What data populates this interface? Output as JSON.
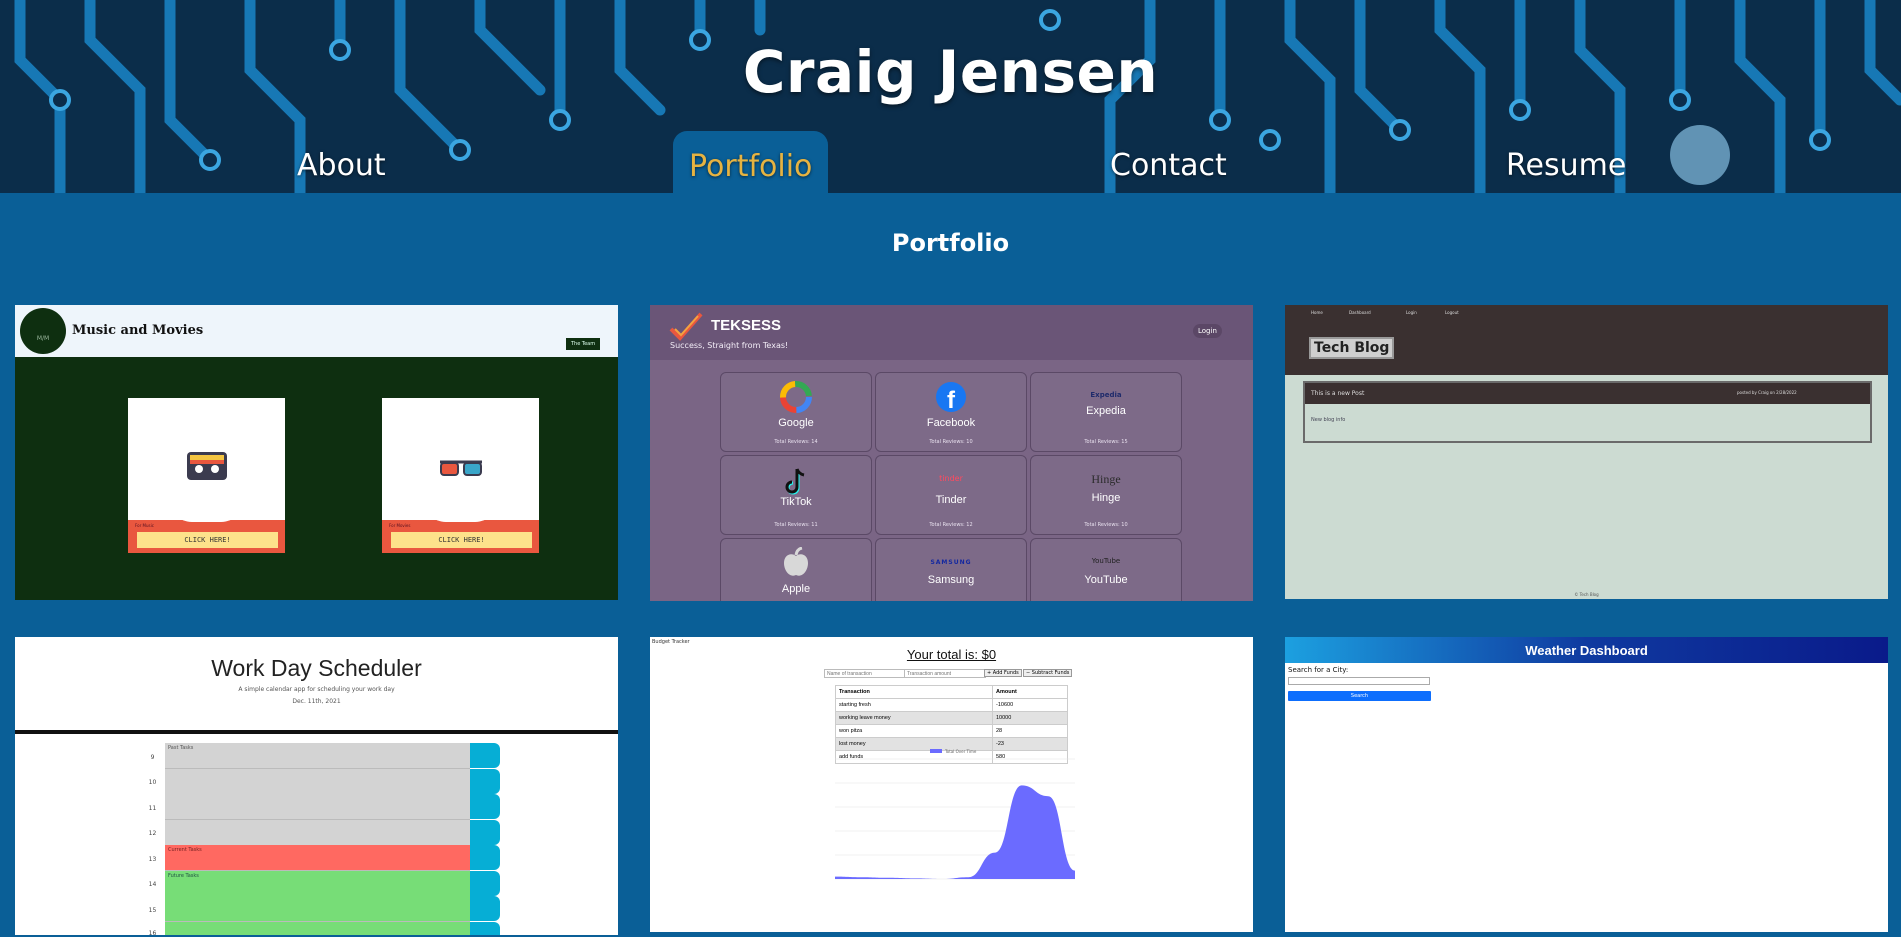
{
  "site": {
    "title": "Craig Jensen"
  },
  "nav": [
    {
      "label": "About",
      "active": false
    },
    {
      "label": "Portfolio",
      "active": true
    },
    {
      "label": "Contact",
      "active": false
    },
    {
      "label": "Resume",
      "active": false
    }
  ],
  "section": {
    "title": "Portfolio"
  },
  "projects": {
    "music": {
      "title": "Music and Movies",
      "logo_text": "M/M",
      "team_button": "The Team",
      "cards": [
        {
          "label": "For Music",
          "button": "CLICK HERE!",
          "icon": "cassette-icon"
        },
        {
          "label": "For Movies",
          "button": "CLICK HERE!",
          "icon": "3d-glasses-icon"
        }
      ]
    },
    "teksess": {
      "brand": "TEKSESS",
      "tagline": "Success, Straight from Texas!",
      "login": "Login",
      "tiles": [
        {
          "name": "Google",
          "reviews": "Total Reviews: 14",
          "icon": "google-icon"
        },
        {
          "name": "Facebook",
          "reviews": "Total Reviews: 10",
          "icon": "facebook-icon"
        },
        {
          "name": "Expedia",
          "reviews": "Total Reviews: 15",
          "icon": "expedia-icon",
          "logo_text": "Expedia"
        },
        {
          "name": "TikTok",
          "reviews": "Total Reviews: 11",
          "icon": "tiktok-icon"
        },
        {
          "name": "Tinder",
          "reviews": "Total Reviews: 12",
          "icon": "tinder-icon",
          "logo_text": "tinder"
        },
        {
          "name": "Hinge",
          "reviews": "Total Reviews: 10",
          "icon": "hinge-icon",
          "logo_text": "Hinge"
        },
        {
          "name": "Apple",
          "reviews": "",
          "icon": "apple-icon"
        },
        {
          "name": "Samsung",
          "reviews": "",
          "icon": "samsung-icon",
          "logo_text": "SAMSUNG"
        },
        {
          "name": "YouTube",
          "reviews": "",
          "icon": "youtube-icon",
          "logo_text": "YouTube"
        }
      ]
    },
    "techblog": {
      "nav": [
        "Home",
        "Dashboard",
        "Login",
        "Logout"
      ],
      "title": "Tech Blog",
      "post_title": "This is a new Post",
      "post_meta": "posted by Craig on 2/28/2022",
      "post_body": "New blog info",
      "footer": "© Tech Blog"
    },
    "scheduler": {
      "title": "Work Day Scheduler",
      "subtitle": "A simple calendar app for scheduling your work day",
      "date": "Dec. 11th, 2021",
      "hours": [
        "9",
        "10",
        "11",
        "12",
        "13",
        "14",
        "15",
        "16"
      ],
      "past_label": "Past Tasks",
      "current_label": "Current Tasks",
      "future_label": "Future Tasks",
      "colors": {
        "past": "#d3d3d3",
        "present": "#ff6961",
        "future": "#77dd77",
        "save": "#06aed5"
      }
    },
    "budget": {
      "app_label": "Budget Tracker",
      "total": "Your total is: $0",
      "name_placeholder": "Name of transaction",
      "amount_placeholder": "Transaction amount",
      "add_button": "+ Add Funds",
      "subtract_button": "− Subtract Funds",
      "table_headers": [
        "Transaction",
        "Amount"
      ],
      "rows": [
        [
          "starting fresh",
          "-10600"
        ],
        [
          "working leave money",
          "10000"
        ],
        [
          "won pitza",
          "28"
        ],
        [
          "lost money",
          "-23"
        ],
        [
          "add funds",
          "580"
        ]
      ],
      "legend": "Total Over Time"
    },
    "weather": {
      "title": "Weather Dashboard",
      "search_label": "Search for a City:",
      "search_button": "Search"
    }
  },
  "chart_data": {
    "type": "area",
    "title": "",
    "series": [
      {
        "name": "Total Over Time",
        "values": [
          200,
          150,
          100,
          50,
          0,
          150,
          2200,
          7800,
          6900,
          700
        ]
      }
    ],
    "x": [
      1,
      2,
      3,
      4,
      5,
      6,
      7,
      8,
      9,
      10
    ],
    "ylim": [
      0,
      10000
    ],
    "grid": true,
    "legend_position": "top"
  }
}
